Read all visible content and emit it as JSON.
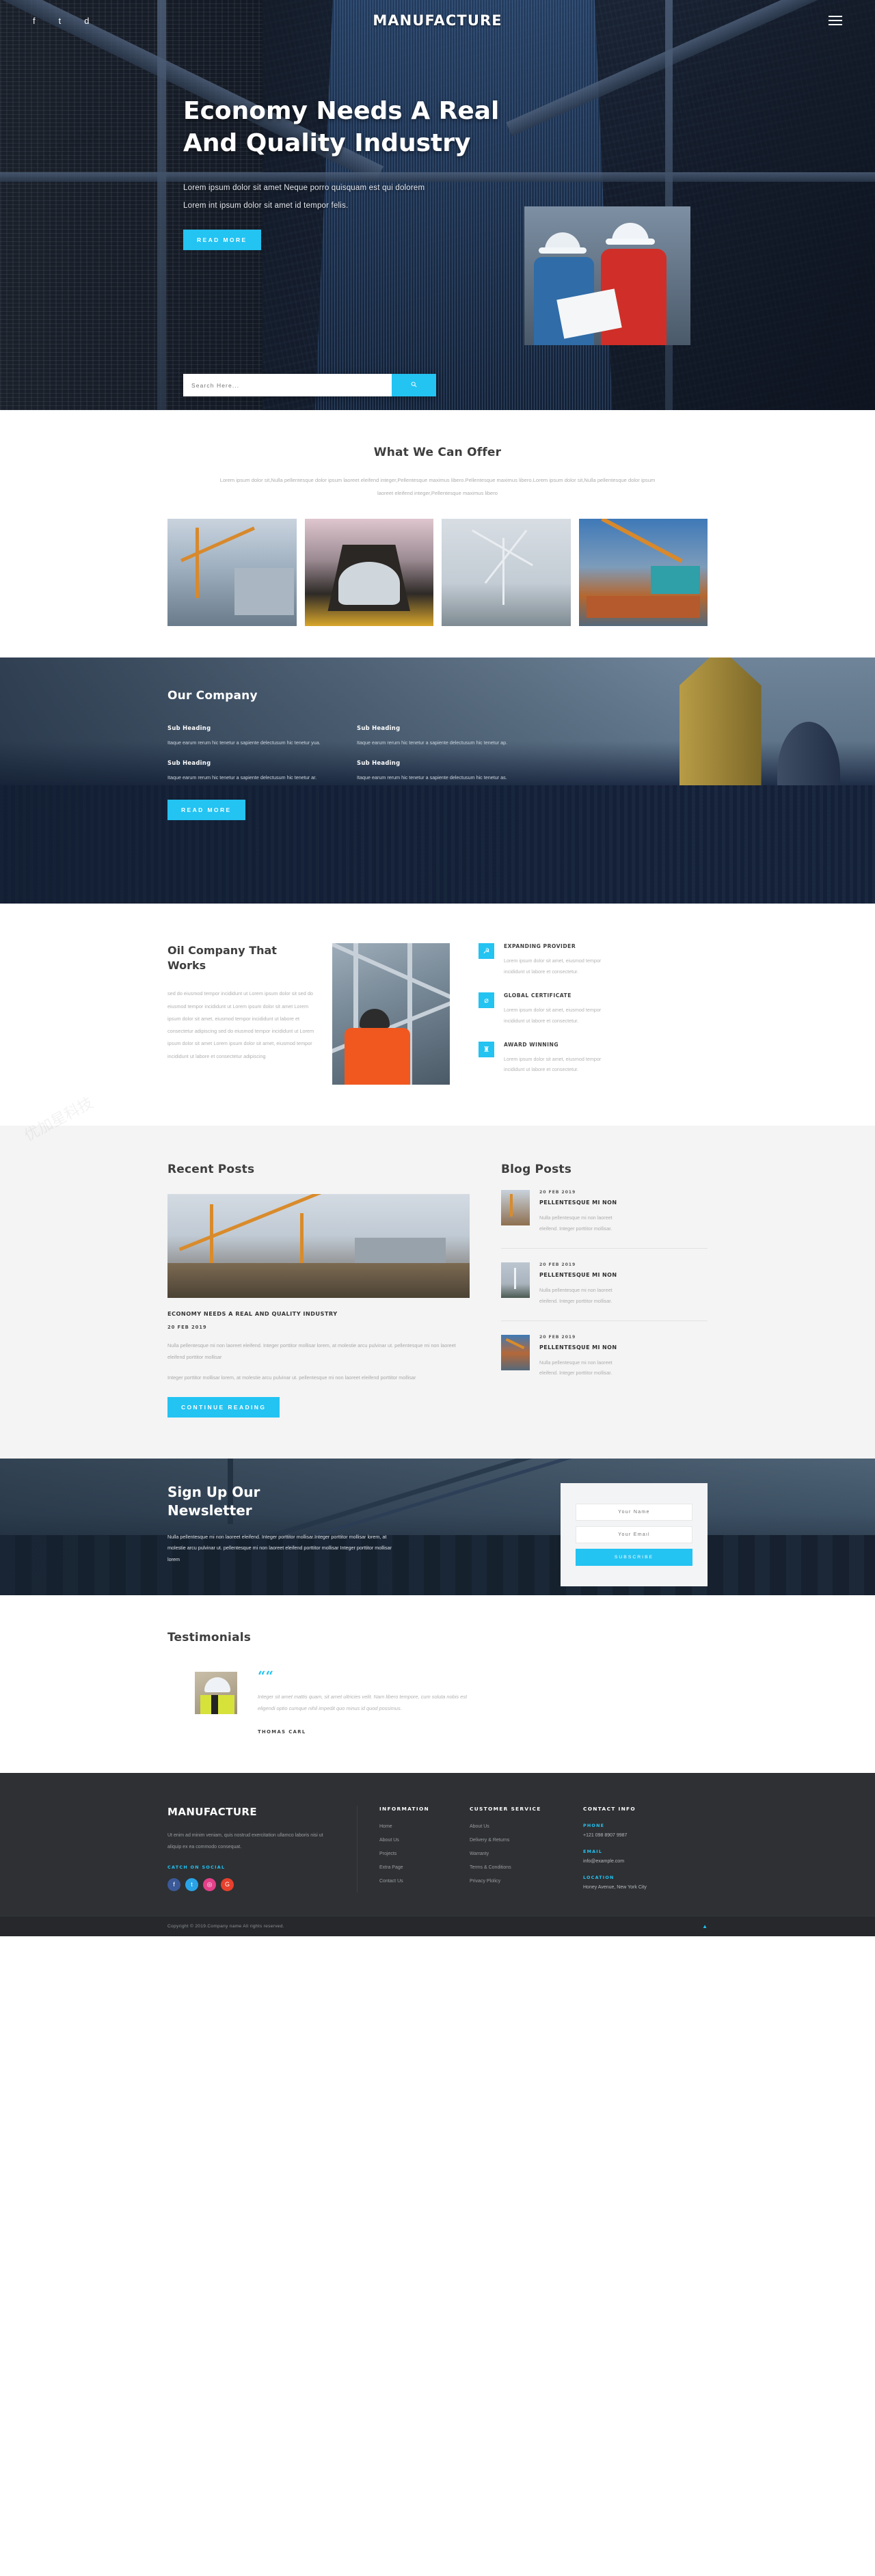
{
  "header": {
    "brand": "MANUFACTURE",
    "social": [
      "f",
      "t",
      "d"
    ],
    "menu_icon": "hamburger-menu-icon"
  },
  "hero": {
    "title_line1": "Economy Needs A Real",
    "title_line2": "And Quality Industry",
    "sub_line1": "Lorem ipsum dolor sit amet Neque porro quisquam est qui dolorem",
    "sub_line2": "Lorem int ipsum dolor sit amet id tempor felis.",
    "cta": "READ MORE",
    "search_placeholder": "Search Here...",
    "search_value": "",
    "search_icon": "search-icon"
  },
  "offer": {
    "title": "What We Can Offer",
    "desc_line1": "Lorem ipsum dolor sit,Nulla pellentesque dolor ipsum laoreet eleifend integer,Pellentesque maximus libero.Pellentesque maximus",
    "desc_line2": "libero.Lorem ipsum dolor sit,Nulla pellentesque dolor ipsum laoreet eleifend integer,Pellentesque maximus libero",
    "cards": [
      {
        "name": "construction-crane-photo"
      },
      {
        "name": "shipyard-drydock-photo"
      },
      {
        "name": "wind-turbine-photo"
      },
      {
        "name": "harbor-crane-photo"
      }
    ]
  },
  "company": {
    "title": "Our Company",
    "cta": "READ MORE",
    "items": [
      {
        "heading": "Sub Heading",
        "text": "Itaque earum rerum hic tenetur a sapiente delectusum hic tenetur yua."
      },
      {
        "heading": "Sub Heading",
        "text": "Itaque earum rerum hic tenetur a sapiente delectusum hic tenetur ap."
      },
      {
        "heading": "Sub Heading",
        "text": "Itaque earum rerum hic tenetur a sapiente delectusum hic tenetur ar."
      },
      {
        "heading": "Sub Heading",
        "text": "Itaque earum rerum hic tenetur a sapiente delectusum hic tenetur as."
      }
    ]
  },
  "oil": {
    "title_line1": "Oil Company That",
    "title_line2": "Works",
    "body": "sed do eiusmod tempor incididunt ut Lorem ipsum dolor sit sed do eiusmod tempor incididunt ut Lorem ipsum dolor sit amet Lorem ipsum dolor sit amet, eiusmod tempor incididunt ut labore et consectetur adipiscing sed do eiusmod tempor incididunt ut Lorem ipsum dolor sit amet Lorem ipsum dolor sit amet, eiusmod tempor incididunt ut labore et consectetur adipiscing",
    "photo_name": "worker-on-platform-photo",
    "features": [
      {
        "icon": "handshake-icon",
        "glyph": "☭",
        "title": "EXPANDING PROVIDER",
        "text": "Lorem ipsum dolor sit amet, eiusmod tempor incididunt ut labore et consectetur."
      },
      {
        "icon": "globe-icon",
        "glyph": "⌀",
        "title": "GLOBAL CERTIFICATE",
        "text": "Lorem ipsum dolor sit amet, eiusmod tempor incididunt ut labore et consectetur."
      },
      {
        "icon": "trophy-icon",
        "glyph": "♜",
        "title": "AWARD WINNING",
        "text": "Lorem ipsum dolor sit amet, eiusmod tempor incididunt ut labore et consectetur."
      }
    ]
  },
  "recent": {
    "title": "Recent Posts",
    "featured_image_name": "shipyard-containers-photo",
    "post_title": "ECONOMY NEEDS A REAL AND QUALITY INDUSTRY",
    "post_date": "20 FEB 2019",
    "para1": "Nulla pellentesque mi non laoreet eleifend. Integer porttitor mollisar lorem, at molestie arcu pulvinar ut. pellentesque mi non laoreet eleifend porttitor mollisar",
    "para2": "Integer porttitor mollisar lorem, at molestie arcu pulvinar ut. pellentesque mi non laoreet eleifend porttitor mollisar",
    "cta": "CONTINUE READING"
  },
  "blog": {
    "title": "Blog Posts",
    "items": [
      {
        "date": "20 FEB 2019",
        "title": "PELLENTESQUE MI NON",
        "text": "Nulla pellentesque mi non laoreet eleifend. Integer porttitor mollisar.",
        "thumb": "construction-crane-thumb"
      },
      {
        "date": "20 FEB 2019",
        "title": "PELLENTESQUE MI NON",
        "text": "Nulla pellentesque mi non laoreet eleifend. Integer porttitor mollisar.",
        "thumb": "wind-turbine-thumb"
      },
      {
        "date": "20 FEB 2019",
        "title": "PELLENTESQUE MI NON",
        "text": "Nulla pellentesque mi non laoreet eleifend. Integer porttitor mollisar.",
        "thumb": "harbor-crane-thumb"
      }
    ]
  },
  "newsletter": {
    "title_line1": "Sign Up Our",
    "title_line2": "Newsletter",
    "desc": "Nulla pellentesque mi non laoreet eleifend. Integer porttitor mollisar.Integer porttitor mollisar lorem, at molestie arcu pulvinar ut. pellentesque mi non laoreet eleifend porttitor mollisar Integer porttitor mollisar lorem",
    "name_placeholder": "Your Name",
    "name_value": "",
    "email_placeholder": "Your Email",
    "email_value": "",
    "submit": "SUBSCRIBE"
  },
  "testimonials": {
    "title": "Testimonials",
    "quote_icon": "quote-mark-icon",
    "avatar_name": "testimonial-avatar",
    "quote": "Integer sit amet mattis quam, sit amet ultricies velit. Nam libero tempore, cum soluta nobis est eligendi optio cumque nihil impedit quo minus id quod possimus.",
    "author": "THOMAS CARL"
  },
  "footer": {
    "brand": "MANUFACTURE",
    "desc": "Ut enim ad minim veniam, quis nostrud exercitation ullamco laboris nisi ut aliquip ex ea commodo consequat.",
    "social_label": "CATCH ON SOCIAL",
    "social": [
      {
        "name": "facebook-icon",
        "glyph": "f",
        "color": "#3b5998"
      },
      {
        "name": "twitter-icon",
        "glyph": "t",
        "color": "#29a3e8"
      },
      {
        "name": "instagram-icon",
        "glyph": "◎",
        "color": "#e4408a"
      },
      {
        "name": "google-plus-icon",
        "glyph": "G",
        "color": "#e7402c"
      }
    ],
    "information": {
      "heading": "INFORMATION",
      "links": [
        "Home",
        "About Us",
        "Projects",
        "Extra Page",
        "Contact Us"
      ]
    },
    "customer_service": {
      "heading": "CUSTOMER SERVICE",
      "links": [
        "About Us",
        "Delivery & Returns",
        "Warranty",
        "Terms & Conditions",
        "Privacy Plolicy"
      ]
    },
    "contact": {
      "heading": "CONTACT INFO",
      "phone_label": "PHONE",
      "phone_value": "+121 098 8907 9987",
      "email_label": "EMAIL",
      "email_value": "info@example.com",
      "location_label": "LOCATION",
      "location_value": "Honey Avenue, New York City"
    },
    "copyright": "Copyright © 2019.Company name All rights reserved.",
    "to_top_icon": "scroll-to-top-icon"
  },
  "theme": {
    "accent": "#23c3f2",
    "dark": "#2e3033",
    "muted": "#adadad"
  }
}
